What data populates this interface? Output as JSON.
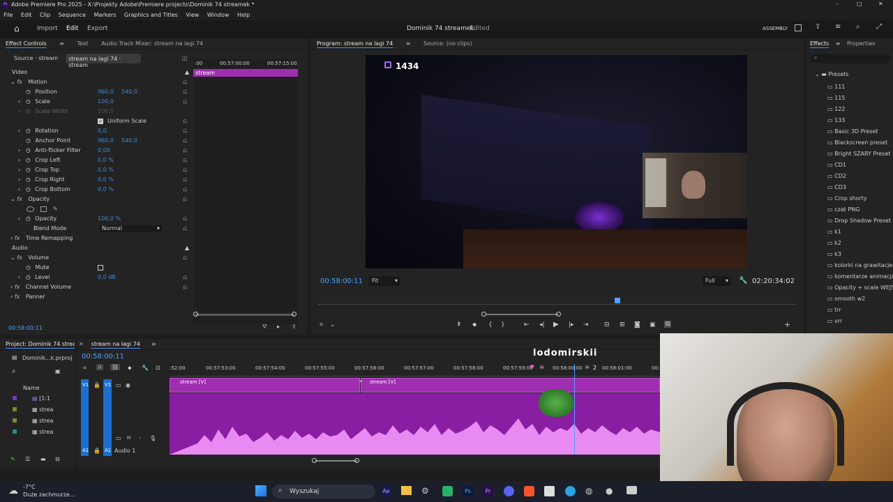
{
  "window": {
    "title": "Adobe Premiere Pro 2025 - X:\\Projekty Adobe\\Premiere projects\\Dominik 74 streamek *",
    "controls": [
      "–",
      "□",
      "✕"
    ]
  },
  "menu": [
    "File",
    "Edit",
    "Clip",
    "Sequence",
    "Markers",
    "Graphics and Titles",
    "View",
    "Window",
    "Help"
  ],
  "header": {
    "import": "Import",
    "edit": "Edit",
    "export": "Export",
    "project_title": "Dominik 74 streamek",
    "status": "- Edited",
    "workspace": "ASSEMBLY"
  },
  "effect_controls": {
    "tabs": [
      "Effect Controls",
      "Text",
      "Audio Track Mixer: stream na lagi 74"
    ],
    "source": "Source · stream",
    "clip": "stream na lagi 74 · stream",
    "ruler": [
      ":00",
      "00:57:00:00",
      "00:57:15:00"
    ],
    "clip_label": "stream",
    "section_video": "Video",
    "section_audio": "Audio",
    "motion": "Motion",
    "params": [
      {
        "name": "Position",
        "v1": "960,0",
        "v2": "540,0"
      },
      {
        "name": "Scale",
        "v1": "100,0",
        "v2": ""
      },
      {
        "name": "Scale Width",
        "v1": "100,0",
        "v2": ""
      },
      {
        "name": "Rotation",
        "v1": "0,0",
        "v2": ""
      },
      {
        "name": "Anchor Point",
        "v1": "960,0",
        "v2": "540,0"
      },
      {
        "name": "Anti-flicker Filter",
        "v1": "0,00",
        "v2": ""
      },
      {
        "name": "Crop Left",
        "v1": "0,0 %",
        "v2": ""
      },
      {
        "name": "Crop Top",
        "v1": "0,0 %",
        "v2": ""
      },
      {
        "name": "Crop Right",
        "v1": "0,0 %",
        "v2": ""
      },
      {
        "name": "Crop Bottom",
        "v1": "0,0 %",
        "v2": ""
      }
    ],
    "uniform_scale": "Uniform Scale",
    "opacity": "Opacity",
    "opacity_value": "100,0 %",
    "blend_mode_label": "Blend Mode",
    "blend_mode": "Normal",
    "time_remapping": "Time Remapping",
    "volume": "Volume",
    "mute": "Mute",
    "level": "Level",
    "level_value": "0,0 dB",
    "channel_volume": "Channel Volume",
    "panner": "Panner",
    "timecode": "00:58:00:11"
  },
  "program": {
    "tabs": [
      "Program: stream na lagi 74",
      "Source: (no clips)"
    ],
    "overlay_count": "1434",
    "timecode": "00:58:00:11",
    "fit": "Fit",
    "quality": "Full",
    "duration": "02:20:34:02"
  },
  "effects": {
    "tabs": [
      "Effects",
      "Properties"
    ],
    "folder": "Presets",
    "items": [
      "111",
      "115",
      "122",
      "133",
      "Basic 3D Preset",
      "Blackscreen preset",
      "Bright SZARY Preset",
      "CD1",
      "CD2",
      "CD3",
      "Crop shorty",
      "czat PNG",
      "Drop Shadow Preset",
      "k1",
      "k2",
      "k3",
      "kolorki na grawitacje",
      "komentarze animacja",
      "Opacity + scale WEJS",
      "smooth w2",
      "trr",
      "vrr"
    ]
  },
  "project": {
    "tab": "Project: Dominik 74 streamek",
    "file": "Dominik...k.prproj",
    "name_header": "Name",
    "items": [
      "[1:1",
      "strea",
      "strea",
      "strea"
    ]
  },
  "timeline": {
    "tab": "stream na lagi 74",
    "timecode": "00:58:00:11",
    "ruler": [
      ":52:00",
      "00:57:53:00",
      "00:57:54:00",
      "00:57:55:00",
      "00:57:56:00",
      "00:57:57:00",
      "00:57:58:00",
      "00:57:59:00",
      "00:58:00:00",
      "00:58:01:00",
      "00:5"
    ],
    "clip1": "stream [V]",
    "clip2": "stream [V]",
    "v1": "V1",
    "a1": "A1",
    "audio_name": "Audio 1",
    "overlay_name": "lodomirskii",
    "overlay_count": "2"
  },
  "taskbar": {
    "temp": "-7°C",
    "weather": "Duże zachmurze...",
    "search": "Wyszukaj"
  },
  "colors": {
    "clip": "#a02eb0",
    "accent": "#3c8be0",
    "timecode": "#4aa3ff"
  }
}
